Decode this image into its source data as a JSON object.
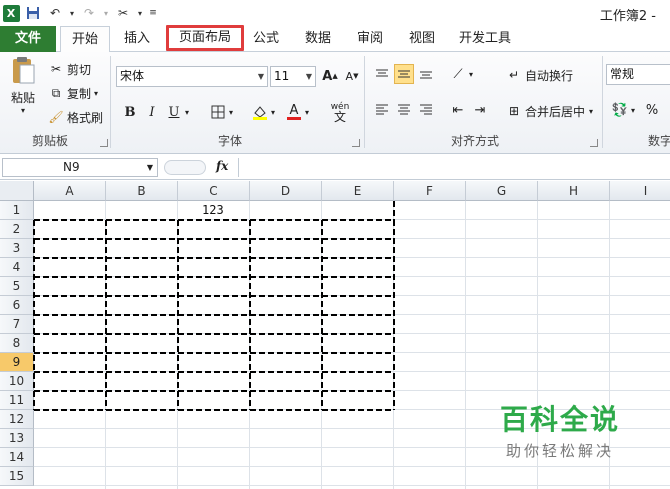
{
  "titlebar": {
    "app_icon_label": "X",
    "doc_title": "工作簿2 - "
  },
  "tabs": [
    {
      "label": "文件"
    },
    {
      "label": "开始"
    },
    {
      "label": "插入"
    },
    {
      "label": "页面布局"
    },
    {
      "label": "公式"
    },
    {
      "label": "数据"
    },
    {
      "label": "审阅"
    },
    {
      "label": "视图"
    },
    {
      "label": "开发工具"
    }
  ],
  "ribbon": {
    "clipboard": {
      "paste_label": "粘贴",
      "cut_label": "剪切",
      "copy_label": "复制",
      "format_painter_label": "格式刷",
      "group_label": "剪贴板"
    },
    "font": {
      "font_name": "宋体",
      "font_size": "11",
      "bold": "B",
      "italic": "I",
      "underline": "U",
      "group_label": "字体"
    },
    "alignment": {
      "wrap_text_label": "自动换行",
      "merge_center_label": "合并后居中",
      "group_label": "对齐方式"
    },
    "number": {
      "format_value": "常规",
      "percent": "%",
      "group_label": "数字"
    }
  },
  "formula_bar": {
    "name_box": "N9",
    "fx": "fx",
    "formula": ""
  },
  "grid": {
    "columns": [
      "A",
      "B",
      "C",
      "D",
      "E",
      "F",
      "G",
      "H",
      "I"
    ],
    "rows": [
      "1",
      "2",
      "3",
      "4",
      "5",
      "6",
      "7",
      "8",
      "9",
      "10",
      "11",
      "12",
      "13",
      "14",
      "15"
    ],
    "selected_row": "9",
    "cells": {
      "C1": "123"
    }
  },
  "watermark": {
    "title": "百科全说",
    "subtitle": "助你轻松解决"
  },
  "colors": {
    "file_tab": "#2e7d32",
    "highlight_box": "#e03c3c",
    "selected_row_header": "#f7c96a",
    "watermark_green": "#2eaa4a"
  }
}
